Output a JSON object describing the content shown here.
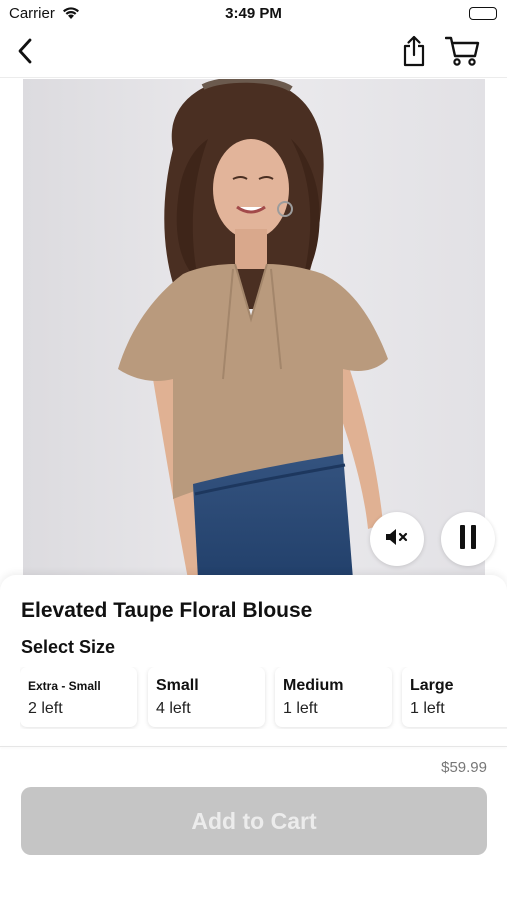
{
  "status_bar": {
    "carrier": "Carrier",
    "time": "3:49 PM"
  },
  "nav": {
    "back_icon": "chevron-left-icon",
    "share_icon": "share-icon",
    "cart_icon": "cart-icon"
  },
  "video": {
    "mute_icon": "speaker-muted-icon",
    "pause_icon": "pause-icon"
  },
  "product": {
    "title": "Elevated Taupe Floral Blouse",
    "select_size_label": "Select Size",
    "sizes": [
      {
        "name": "Extra - Small",
        "stock": "2 left"
      },
      {
        "name": "Small",
        "stock": "4 left"
      },
      {
        "name": "Medium",
        "stock": "1 left"
      },
      {
        "name": "Large",
        "stock": "1 left"
      }
    ],
    "price": "$59.99",
    "add_to_cart_label": "Add to Cart"
  },
  "colors": {
    "button_disabled_bg": "#c5c5c5",
    "button_disabled_text": "#ececec",
    "blouse": "#b99a7d",
    "jeans": "#2c4a78",
    "backdrop": "#e8e7ea"
  }
}
